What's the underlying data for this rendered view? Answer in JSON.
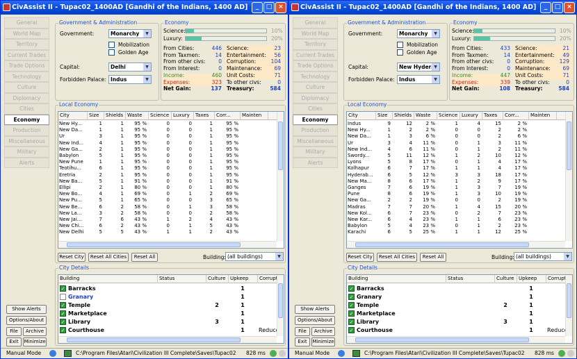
{
  "windows": [
    {
      "title": "CivAssist II - Tupac02_1400AD [Gandhi of the Indians, 1400 AD]",
      "nav": [
        "General",
        "World Map",
        "Territory",
        "Current Trades",
        "Trade Options",
        "Technology",
        "Culture",
        "Diplomacy",
        "Cities",
        "Economy",
        "Production",
        "Miscellaneous",
        "Military",
        "Alerts"
      ],
      "nav_active": 9,
      "bottom_buttons": {
        "show_alerts": "Show Alerts",
        "options": "Options/About",
        "file": "File",
        "archive": "Archive",
        "exit": "Exit",
        "minimize": "Minimize"
      },
      "gov": {
        "title": "Government & Administration",
        "gov_label": "Government:",
        "gov_value": "Monarchy",
        "mobilization": "Mobilization",
        "golden_age": "Golden Age",
        "capital_label": "Capital:",
        "capital_value": "Delhi",
        "forbidden_label": "Forbidden Palace:",
        "forbidden_value": "Indus"
      },
      "econ": {
        "title": "Economy",
        "science_label": "Science:",
        "science_pct": "10%",
        "science_fill": 0.1,
        "luxury_label": "Luxury:",
        "luxury_pct": "20%",
        "luxury_fill": 0.2,
        "left": [
          {
            "l": "From Cities:",
            "v": "446"
          },
          {
            "l": "From Taxmen:",
            "v": "14"
          },
          {
            "l": "From other civs:",
            "v": "0"
          },
          {
            "l": "From Interest:",
            "v": "0"
          },
          {
            "l": "Income:",
            "v": "460"
          },
          {
            "l": "Expenses:",
            "v": "323"
          },
          {
            "l": "Net Gain:",
            "v": "137"
          }
        ],
        "right": [
          {
            "l": "Science:",
            "v": "23"
          },
          {
            "l": "Entertainment:",
            "v": "56"
          },
          {
            "l": "Corruption:",
            "v": "104"
          },
          {
            "l": "Maintenance:",
            "v": "69"
          },
          {
            "l": "Unit Costs:",
            "v": "71"
          },
          {
            "l": "To other civs:",
            "v": "0"
          },
          {
            "l": "Treasury:",
            "v": "584"
          }
        ]
      },
      "local": {
        "title": "Local Economy",
        "headers": [
          "City",
          "Size",
          "Shields",
          "Waste",
          "Science",
          "Luxury",
          "Taxes",
          "Corr...",
          "Mainten"
        ],
        "rows": [
          [
            "New Hy...",
            "1",
            "1",
            "95 %",
            "0",
            "0",
            "1",
            "95 %"
          ],
          [
            "New Da...",
            "1",
            "1",
            "95 %",
            "0",
            "0",
            "1",
            "95 %"
          ],
          [
            "Ur",
            "3",
            "1",
            "95 %",
            "0",
            "0",
            "1",
            "95 %"
          ],
          [
            "New Ind...",
            "4",
            "1",
            "95 %",
            "0",
            "0",
            "1",
            "95 %"
          ],
          [
            "New Ga...",
            "2",
            "1",
            "95 %",
            "0",
            "0",
            "1",
            "95 %"
          ],
          [
            "Babylon",
            "5",
            "1",
            "95 %",
            "0",
            "0",
            "1",
            "95 %"
          ],
          [
            "New Pune",
            "1",
            "1",
            "95 %",
            "0",
            "0",
            "1",
            "95 %"
          ],
          [
            "Teotihu...",
            "6",
            "1",
            "95 %",
            "0",
            "0",
            "1",
            "95 %"
          ],
          [
            "Eretria",
            "2",
            "1",
            "95 %",
            "0",
            "0",
            "1",
            "95 %"
          ],
          [
            "New Ba...",
            "5",
            "1",
            "91 %",
            "0",
            "0",
            "1",
            "91 %"
          ],
          [
            "Ellipi",
            "2",
            "1",
            "80 %",
            "0",
            "0",
            "1",
            "80 %"
          ],
          [
            "New Bo...",
            "4",
            "1",
            "69 %",
            "0",
            "1",
            "2",
            "69 %"
          ],
          [
            "New Pu...",
            "5",
            "1",
            "65 %",
            "0",
            "0",
            "3",
            "65 %"
          ],
          [
            "New Be...",
            "6",
            "2",
            "58 %",
            "0",
            "1",
            "3",
            "58 %"
          ],
          [
            "New La...",
            "3",
            "2",
            "58 %",
            "0",
            "0",
            "2",
            "58 %"
          ],
          [
            "New Jai...",
            "7",
            "6",
            "43 %",
            "1",
            "2",
            "4",
            "43 %"
          ],
          [
            "New Chi...",
            "6",
            "2",
            "43 %",
            "0",
            "1",
            "5",
            "43 %"
          ],
          [
            "New Delhi",
            "5",
            "5",
            "43 %",
            "1",
            "1",
            "2",
            "43 %"
          ]
        ],
        "reset_city": "Reset City",
        "reset_all": "Reset All Cities",
        "reset_all2": "Reset All",
        "building_label": "Building:",
        "building_value": "(all buildings)"
      },
      "details": {
        "title": "City Details",
        "headers": [
          "Building",
          "Status",
          "Culture",
          "Upkeep",
          "Corrupti"
        ],
        "rows": [
          {
            "name": "Barracks",
            "checked": true,
            "status": "",
            "culture": "",
            "upkeep": "1",
            "corr": ""
          },
          {
            "name": "Granary",
            "checked": false,
            "status": "",
            "culture": "",
            "upkeep": "1",
            "corr": ""
          },
          {
            "name": "Temple",
            "checked": true,
            "status": "",
            "culture": "2",
            "upkeep": "1",
            "corr": ""
          },
          {
            "name": "Marketplace",
            "checked": true,
            "status": "",
            "culture": "",
            "upkeep": "1",
            "corr": ""
          },
          {
            "name": "Library",
            "checked": true,
            "status": "",
            "culture": "3",
            "upkeep": "1",
            "corr": ""
          },
          {
            "name": "Courthouse",
            "checked": true,
            "status": "",
            "culture": "",
            "upkeep": "1",
            "corr": "Reduce"
          }
        ]
      },
      "status": {
        "mode": "Manual Mode",
        "path": "C:\\Program Files\\Atari\\Civilization III Complete\\Saves\\Tupac02",
        "ms": "828 ms"
      }
    },
    {
      "title": "CivAssist II - Tupac02_1400AD [Gandhi of the Indians, 1400 AD]",
      "nav": [
        "General",
        "World Map",
        "Territory",
        "Current Trades",
        "Trade Options",
        "Technology",
        "Culture",
        "Diplomacy",
        "Cities",
        "Economy",
        "Production",
        "Miscellaneous",
        "Military",
        "Alerts"
      ],
      "nav_active": 9,
      "bottom_buttons": {
        "show_alerts": "Show Alerts",
        "options": "Options/About",
        "file": "File",
        "archive": "Archive",
        "exit": "Exit",
        "minimize": "Minimize"
      },
      "gov": {
        "title": "Government & Administration",
        "gov_label": "Government:",
        "gov_value": "Monarchy",
        "mobilization": "Mobilization",
        "golden_age": "Golden Age",
        "capital_label": "Capital:",
        "capital_value": "New Hyderal",
        "forbidden_label": "Forbidden Palace:",
        "forbidden_value": "Indus"
      },
      "econ": {
        "title": "Economy",
        "science_label": "Science:",
        "science_pct": "10%",
        "science_fill": 0.1,
        "luxury_label": "Luxury:",
        "luxury_pct": "20%",
        "luxury_fill": 0.2,
        "left": [
          {
            "l": "From Cities:",
            "v": "433"
          },
          {
            "l": "From Taxmen:",
            "v": "14"
          },
          {
            "l": "From other civs:",
            "v": "0"
          },
          {
            "l": "From Interest:",
            "v": "0"
          },
          {
            "l": "Income:",
            "v": "447"
          },
          {
            "l": "Expenses:",
            "v": "339"
          },
          {
            "l": "Net Gain:",
            "v": "108"
          }
        ],
        "right": [
          {
            "l": "Science:",
            "v": "21"
          },
          {
            "l": "Entertainment:",
            "v": "49"
          },
          {
            "l": "Corruption:",
            "v": "129"
          },
          {
            "l": "Maintenance:",
            "v": "69"
          },
          {
            "l": "Unit Costs:",
            "v": "71"
          },
          {
            "l": "To other civs:",
            "v": "0"
          },
          {
            "l": "Treasury:",
            "v": "584"
          }
        ]
      },
      "local": {
        "title": "Local Economy",
        "headers": [
          "City",
          "Size",
          "Shields",
          "Waste",
          "Science",
          "Luxury",
          "Taxes",
          "Corr...",
          "Mainten"
        ],
        "rows": [
          [
            "Indus",
            "9",
            "12",
            "2 %",
            "1",
            "4",
            "15",
            "2 %"
          ],
          [
            "New Hy...",
            "1",
            "2",
            "2 %",
            "0",
            "0",
            "2",
            "2 %"
          ],
          [
            "New Da...",
            "1",
            "3",
            "6 %",
            "0",
            "0",
            "2",
            "6 %"
          ],
          [
            "Ur",
            "3",
            "4",
            "11 %",
            "0",
            "1",
            "3",
            "11 %"
          ],
          [
            "New Ind...",
            "4",
            "6",
            "11 %",
            "0",
            "1",
            "2",
            "11 %"
          ],
          [
            "Swordy...",
            "5",
            "11",
            "12 %",
            "1",
            "2",
            "10",
            "12 %"
          ],
          [
            "Lyons",
            "5",
            "8",
            "17 %",
            "0",
            "1",
            "4",
            "17 %"
          ],
          [
            "Kolhapur",
            "6",
            "7",
            "17 %",
            "1",
            "1",
            "4",
            "17 %"
          ],
          [
            "Hyderab...",
            "6",
            "5",
            "12 %",
            "3",
            "3",
            "18",
            "17 %"
          ],
          [
            "New Ma...",
            "8",
            "6",
            "17 %",
            "1",
            "2",
            "9",
            "17 %"
          ],
          [
            "Ganges",
            "7",
            "6",
            "19 %",
            "1",
            "3",
            "7",
            "19 %"
          ],
          [
            "Pune",
            "8",
            "6",
            "19 %",
            "1",
            "3",
            "10",
            "19 %"
          ],
          [
            "New Ga...",
            "2",
            "2",
            "19 %",
            "0",
            "0",
            "2",
            "19 %"
          ],
          [
            "Madras",
            "7",
            "7",
            "20 %",
            "1",
            "4",
            "15",
            "20 %"
          ],
          [
            "New Kol...",
            "6",
            "7",
            "23 %",
            "0",
            "2",
            "7",
            "23 %"
          ],
          [
            "New Kar...",
            "6",
            "4",
            "23 %",
            "1",
            "1",
            "6",
            "23 %"
          ],
          [
            "Babylon",
            "5",
            "4",
            "23 %",
            "0",
            "1",
            "2",
            "23 %"
          ],
          [
            "Karachi",
            "6",
            "5",
            "25 %",
            "1",
            "1",
            "12",
            "25 %"
          ]
        ],
        "reset_city": "Reset City",
        "reset_all": "Reset All Cities",
        "reset_all2": "Reset All",
        "building_label": "Building:",
        "building_value": "(all buildings)"
      },
      "details": {
        "title": "City Details",
        "headers": [
          "Building",
          "Status",
          "Culture",
          "Upkeep",
          "Corrupti"
        ],
        "rows": [
          {
            "name": "Barracks",
            "checked": true,
            "status": "",
            "culture": "",
            "upkeep": "1",
            "corr": ""
          },
          {
            "name": "Granary",
            "checked": true,
            "status": "",
            "culture": "",
            "upkeep": "1",
            "corr": ""
          },
          {
            "name": "Temple",
            "checked": true,
            "status": "",
            "culture": "2",
            "upkeep": "1",
            "corr": ""
          },
          {
            "name": "Marketplace",
            "checked": true,
            "status": "",
            "culture": "",
            "upkeep": "1",
            "corr": ""
          },
          {
            "name": "Library",
            "checked": true,
            "status": "",
            "culture": "3",
            "upkeep": "1",
            "corr": ""
          },
          {
            "name": "Courthouse",
            "checked": true,
            "status": "",
            "culture": "",
            "upkeep": "1",
            "corr": "Reduce"
          }
        ]
      },
      "status": {
        "mode": "Manual Mode",
        "path": "C:\\Program Files\\Atari\\Civilization III Complete\\Saves\\Tupac02",
        "ms": "828 ms"
      }
    }
  ],
  "colors": {
    "accent": "#1c4fd6",
    "titlebar": "#0a4ee0",
    "income": "#2a8a2a",
    "expenses": "#c02020",
    "highlight": "#fde8c8"
  }
}
